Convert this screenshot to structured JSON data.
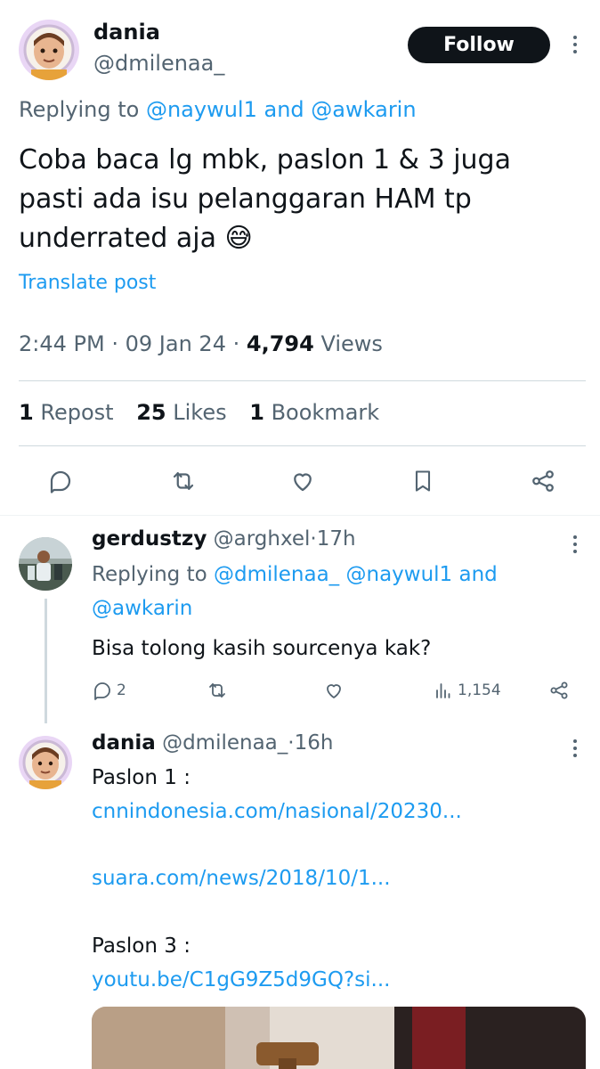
{
  "main_tweet": {
    "display_name": "dania",
    "handle": "@dmilenaa_",
    "follow_label": "Follow",
    "replying_prefix": "Replying to",
    "replying_user1": "@naywul1",
    "replying_and": "and",
    "replying_user2": "@awkarin",
    "text_line1": "Coba baca lg mbk, paslon 1 & 3 juga",
    "text_line2": "pasti ada isu pelanggaran HAM tp",
    "text_line3": "underrated aja",
    "emoji": "😅",
    "translate_label": "Translate post",
    "time": "2:44 PM",
    "dot": "·",
    "date": "09 Jan 24",
    "views_count": "4,794",
    "views_label": "Views",
    "repost_count": "1",
    "repost_label": "Repost",
    "likes_count": "25",
    "likes_label": "Likes",
    "bookmark_count": "1",
    "bookmark_label": "Bookmark"
  },
  "reply1": {
    "display_name": "gerdustzy",
    "handle": "@arghxel",
    "dot": "·",
    "age": "17h",
    "replying_prefix": "Replying to",
    "replying_user1": "@dmilenaa_",
    "replying_user2": "@naywul1",
    "replying_and": "and",
    "replying_user3": "@awkarin",
    "text": "Bisa tolong kasih sourcenya kak?",
    "reply_count": "2",
    "views_count": "1,154"
  },
  "reply2": {
    "display_name": "dania",
    "handle": "@dmilenaa_",
    "dot": "·",
    "age": "16h",
    "line1": "Paslon 1 :",
    "link1": "cnnindonesia.com/nasional/20230...",
    "link2": "suara.com/news/2018/10/1...",
    "line3": "Paslon 3 :",
    "link3": "youtu.be/C1gG9Z5d9GQ?si..."
  },
  "colors": {
    "link": "#1d9bf0",
    "muted": "#536471",
    "text": "#0f1419",
    "divider": "#cfd9de"
  }
}
